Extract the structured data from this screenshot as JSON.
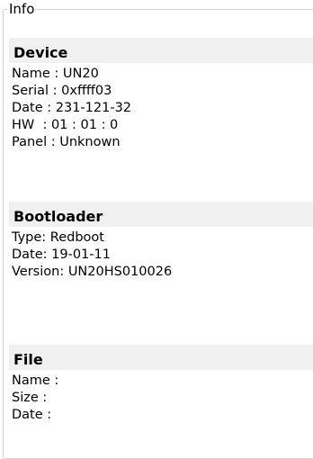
{
  "groupbox_title": "Info",
  "device": {
    "title": "Device",
    "lines": [
      "Name : UN20",
      "Serial : 0xffff03",
      "Date : 231-121-32",
      "HW  : 01 : 01 : 0",
      "Panel : Unknown"
    ]
  },
  "bootloader": {
    "title": "Bootloader",
    "lines": [
      "Type: Redboot",
      "Date: 19-01-11",
      "Version: UN20HS010026"
    ]
  },
  "file": {
    "title": "File",
    "lines": [
      "Name :",
      "Size :",
      "Date :"
    ]
  }
}
